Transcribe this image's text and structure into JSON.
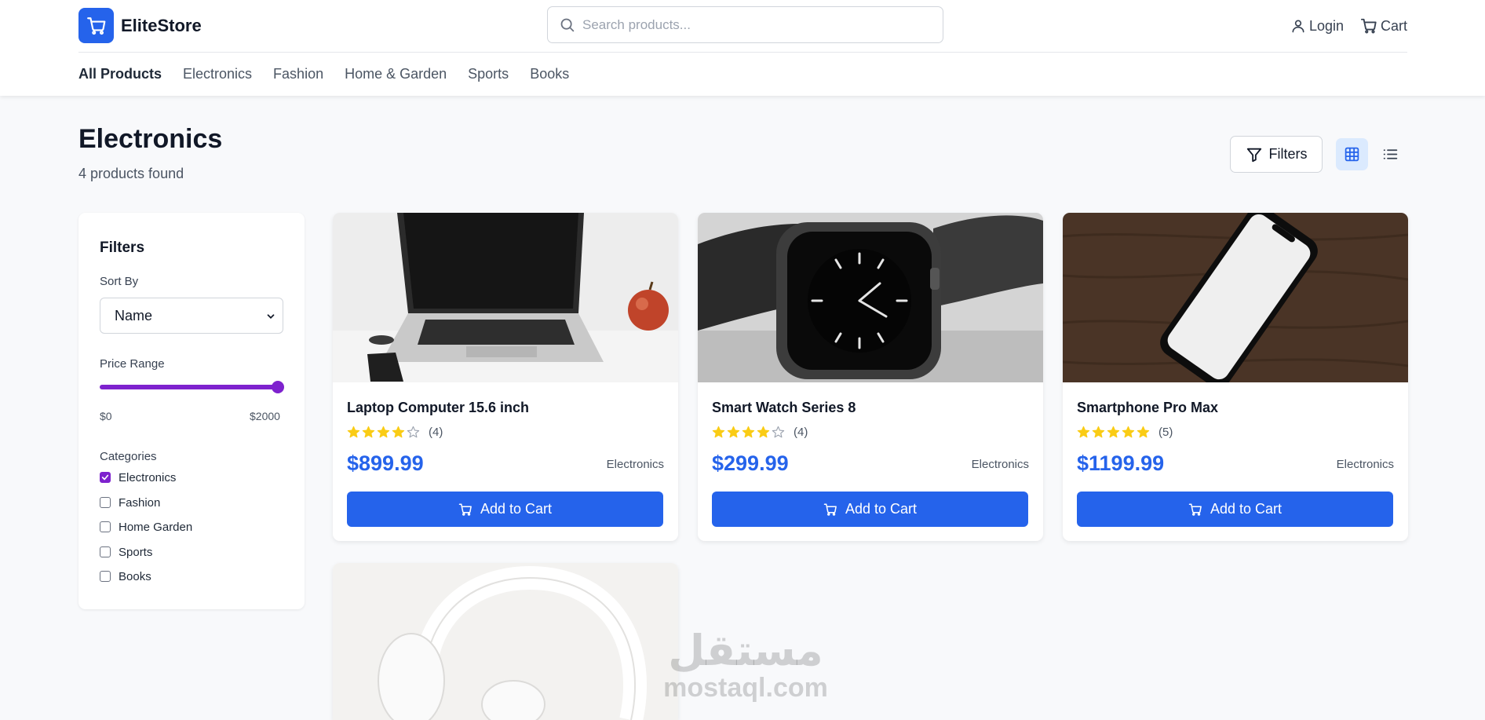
{
  "header": {
    "brand": "EliteStore",
    "search_placeholder": "Search products...",
    "login_label": "Login",
    "cart_label": "Cart"
  },
  "nav": {
    "items": [
      "All Products",
      "Electronics",
      "Fashion",
      "Home & Garden",
      "Sports",
      "Books"
    ],
    "active": "All Products"
  },
  "page": {
    "title": "Electronics",
    "count_text": "4 products found",
    "filters_button": "Filters",
    "view_mode": "grid"
  },
  "sidebar": {
    "title": "Filters",
    "sort_label": "Sort By",
    "sort_value": "Name",
    "price_label": "Price Range",
    "price_min": "$0",
    "price_max": "$2000",
    "price_slider_fraction": 1.0,
    "categories_label": "Categories",
    "categories": [
      {
        "label": "Electronics",
        "checked": true
      },
      {
        "label": "Fashion",
        "checked": false
      },
      {
        "label": "Home Garden",
        "checked": false
      },
      {
        "label": "Sports",
        "checked": false
      },
      {
        "label": "Books",
        "checked": false
      }
    ]
  },
  "products": [
    {
      "name": "Laptop Computer 15.6 inch",
      "rating": 4,
      "reviews": "(4)",
      "price": "$899.99",
      "category": "Electronics",
      "button": "Add to Cart",
      "image": "laptop"
    },
    {
      "name": "Smart Watch Series 8",
      "rating": 4,
      "reviews": "(4)",
      "price": "$299.99",
      "category": "Electronics",
      "button": "Add to Cart",
      "image": "smartwatch"
    },
    {
      "name": "Smartphone Pro Max",
      "rating": 5,
      "reviews": "(5)",
      "price": "$1199.99",
      "category": "Electronics",
      "button": "Add to Cart",
      "image": "smartphone"
    },
    {
      "image": "headphones"
    }
  ],
  "watermark": {
    "arabic": "مستقل",
    "latin": "mostaql.com"
  },
  "colors": {
    "primary": "#2563eb",
    "accent_purple": "#7e22ce",
    "star": "#facc15",
    "background": "#f8f9fb"
  }
}
